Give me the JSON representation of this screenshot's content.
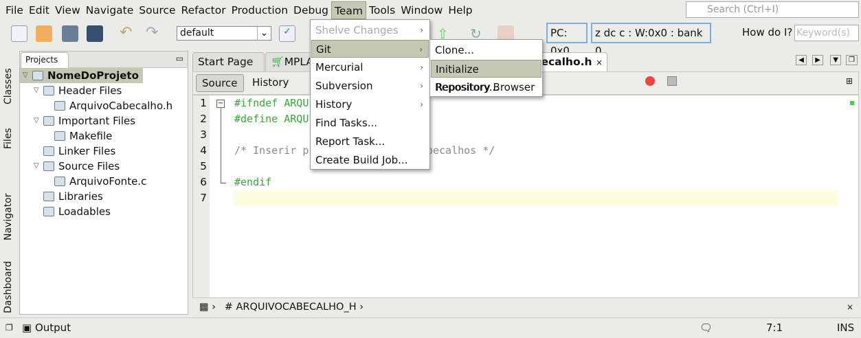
{
  "menubar": {
    "items": [
      "File",
      "Edit",
      "View",
      "Navigate",
      "Source",
      "Refactor",
      "Production",
      "Debug",
      "Team",
      "Tools",
      "Window",
      "Help"
    ],
    "active": "Team",
    "search_placeholder": "Search (Ctrl+I)"
  },
  "toolbar": {
    "configuration": "default",
    "pc": "PC: 0x0",
    "status": "z dc c  : W:0x0 : bank 0",
    "how_do_i": "How do I?",
    "keyword_placeholder": "Keyword(s)"
  },
  "left_strip": {
    "items": [
      "Classes",
      "Files",
      "Navigator",
      "Dashboard"
    ]
  },
  "projects": {
    "tab": "Projects",
    "close": "×",
    "tree": [
      {
        "label": "NomeDoProjeto",
        "level": 0,
        "expanded": true,
        "selected": true
      },
      {
        "label": "Header Files",
        "level": 1,
        "expanded": true
      },
      {
        "label": "ArquivoCabecalho.h",
        "level": 2
      },
      {
        "label": "Important Files",
        "level": 1,
        "expanded": true
      },
      {
        "label": "Makefile",
        "level": 2
      },
      {
        "label": "Linker Files",
        "level": 1
      },
      {
        "label": "Source Files",
        "level": 1,
        "expanded": true
      },
      {
        "label": "ArquivoFonte.c",
        "level": 2
      },
      {
        "label": "Libraries",
        "level": 1
      },
      {
        "label": "Loadables",
        "level": 1
      }
    ]
  },
  "editor": {
    "tabs": [
      {
        "label": "Start Page",
        "close": "×"
      },
      {
        "label": "MPLA",
        "close": ""
      },
      {
        "label": "becalho.h",
        "close": "×",
        "active": true
      }
    ],
    "source_button": "Source",
    "history_button": "History",
    "lines": [
      {
        "n": "1",
        "text": "#ifndef ARQUIVOCABECALHO_H",
        "color": "#3aa63a"
      },
      {
        "n": "2",
        "text": "#define ARQUIVOCABECALHO_H",
        "color": "#3aa63a"
      },
      {
        "n": "3",
        "text": "",
        "color": "#000"
      },
      {
        "n": "4",
        "text": "/* Inserir prototipos aqui / cabecalhos */",
        "color": "#8a8a8a"
      },
      {
        "n": "5",
        "text": "",
        "color": "#000"
      },
      {
        "n": "6",
        "text": "#endif",
        "color": "#3aa63a"
      },
      {
        "n": "7",
        "text": "",
        "color": "#000"
      }
    ],
    "breadcrumb": "ARQUIVOCABECALHO_H",
    "close": "×"
  },
  "status": {
    "output": "Output",
    "position": "7:1",
    "mode": "INS"
  },
  "team_menu": {
    "items": [
      {
        "label": "Shelve Changes",
        "disabled": true,
        "submenu": true
      },
      {
        "label": "Git",
        "submenu": true,
        "highlighted": true
      },
      {
        "label": "Mercurial",
        "submenu": true
      },
      {
        "label": "Subversion",
        "submenu": true
      },
      {
        "label": "History",
        "submenu": true
      },
      {
        "label": "Find Tasks..."
      },
      {
        "label": "Report Task..."
      },
      {
        "label": "Create Build Job..."
      }
    ]
  },
  "git_submenu": {
    "items": [
      {
        "label": "Clone..."
      },
      {
        "label": "Initialize Repository...",
        "highlighted": true
      },
      {
        "label": "Repository Browser"
      }
    ]
  }
}
